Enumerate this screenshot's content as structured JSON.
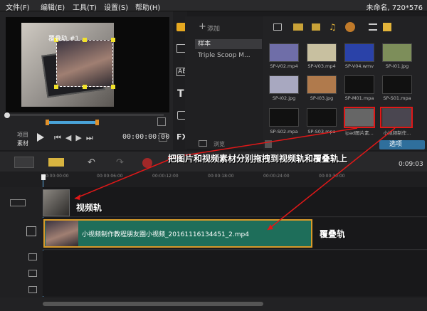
{
  "menu": {
    "items": [
      "文件(F)",
      "编辑(E)",
      "工具(T)",
      "设置(S)",
      "帮助(H)"
    ],
    "title": "未命名, 720*576"
  },
  "preview": {
    "track_label": "覆叠轨 #1",
    "project_label": "项目",
    "clip_label": "素材",
    "timecode": "00:00:00:00"
  },
  "library": {
    "add_label": "添加",
    "list_items": [
      "样本",
      "Triple Scoop M..."
    ],
    "browse_label": "浏览",
    "options_label": "选项",
    "tiles": [
      {
        "caption": "SP-V02.mp4",
        "color": "#6f6ea8"
      },
      {
        "caption": "SP-V03.mp4",
        "color": "#c8c0a0"
      },
      {
        "caption": "SP-V04.wmv",
        "color": "#2a42a8"
      },
      {
        "caption": "SP-I01.jpg",
        "color": "#7d8e5a"
      },
      {
        "caption": "SP-I02.jpg",
        "color": "#a8a8c0"
      },
      {
        "caption": "SP-I03.jpg",
        "color": "#b07a4c"
      },
      {
        "caption": "SP-M01.mpa",
        "color": "#111111"
      },
      {
        "caption": "SP-S01.mpa",
        "color": "#111111"
      },
      {
        "caption": "SP-S02.mpa",
        "color": "#111111"
      },
      {
        "caption": "SP-S03.mpa",
        "color": "#111111"
      },
      {
        "caption": "ipad图片素...",
        "color": "#666666"
      },
      {
        "caption": "小视频制作...",
        "color": "#4a4650"
      }
    ]
  },
  "timeline": {
    "ticks": [
      "00:00:00:00",
      "00:00:06:00",
      "00:00:12:00",
      "00:00:18:00",
      "00:00:24:00",
      "00:00:30:00"
    ],
    "timecode_right": "0:09:03",
    "overlay_clip_text": "小视频制作教程朋友圈小视频_20161116134451_2.mp4"
  },
  "annotations": {
    "instruction": "把图片和视频素材分别拖拽到视频轨和覆叠轨上",
    "video_track": "视频轨",
    "overlay_track": "覆叠轨"
  },
  "colors": {
    "accent": "#2f6f9c",
    "clip_green": "#1e6e5a",
    "annotation_red": "#e01818"
  }
}
